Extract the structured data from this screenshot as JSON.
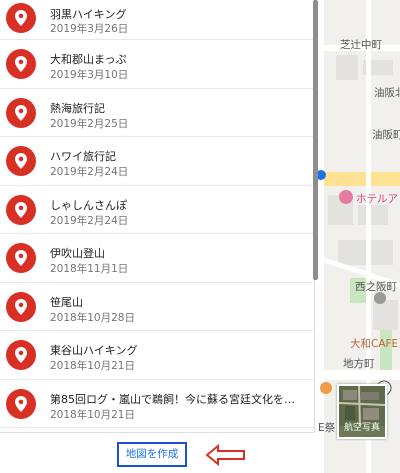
{
  "maps": [
    {
      "title": "羽黒ハイキング",
      "date": "2019年3月26日"
    },
    {
      "title": "大和郡山まっぷ",
      "date": "2019年3月10日"
    },
    {
      "title": "熱海旅行記",
      "date": "2019年2月25日"
    },
    {
      "title": "ハワイ旅行記",
      "date": "2019年2月24日"
    },
    {
      "title": "しゃしんさんぽ",
      "date": "2019年2月24日"
    },
    {
      "title": "伊吹山登山",
      "date": "2018年11月1日"
    },
    {
      "title": "笹尾山",
      "date": "2018年10月28日"
    },
    {
      "title": "東谷山ハイキング",
      "date": "2018年10月21日"
    },
    {
      "title": "第85回ログ・嵐山で鵜飼！今に蘇る宮廷文化を楽し…",
      "date": "2018年10月21日"
    }
  ],
  "footer": {
    "create_map_label": "地図を作成"
  },
  "map": {
    "labels": {
      "shibatsuji": "芝辻中町",
      "aburasaka_kita": "油阪北",
      "aburasaka": "油阪町",
      "hotel": "ホテルア",
      "nishi_aburasaka": "西之阪町",
      "yamato_cafe": "大和CAFE",
      "jikata": "地方町",
      "kyoto_mark": "E祭"
    },
    "map_type_label": "航空写真"
  },
  "colors": {
    "pin": "#d93025",
    "accent": "#1a73e8",
    "highlight": "#d93025"
  }
}
